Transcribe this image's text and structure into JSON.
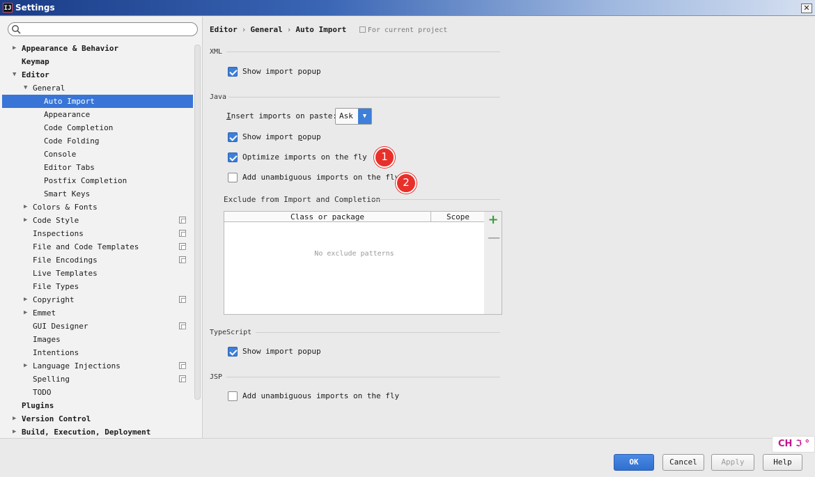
{
  "window": {
    "title": "Settings",
    "app_icon_text": "IJ",
    "close_label": "✕"
  },
  "search": {
    "placeholder": "",
    "value": ""
  },
  "tree": [
    {
      "label": "Appearance & Behavior",
      "depth": 0,
      "bold": true,
      "arrow": "▶",
      "selected": false,
      "project": false
    },
    {
      "label": "Keymap",
      "depth": 0,
      "bold": true,
      "arrow": "",
      "selected": false,
      "project": false
    },
    {
      "label": "Editor",
      "depth": 0,
      "bold": true,
      "arrow": "▼",
      "selected": false,
      "project": false
    },
    {
      "label": "General",
      "depth": 1,
      "bold": false,
      "arrow": "▼",
      "selected": false,
      "project": false
    },
    {
      "label": "Auto Import",
      "depth": 2,
      "bold": false,
      "arrow": "",
      "selected": true,
      "project": false
    },
    {
      "label": "Appearance",
      "depth": 2,
      "bold": false,
      "arrow": "",
      "selected": false,
      "project": false
    },
    {
      "label": "Code Completion",
      "depth": 2,
      "bold": false,
      "arrow": "",
      "selected": false,
      "project": false
    },
    {
      "label": "Code Folding",
      "depth": 2,
      "bold": false,
      "arrow": "",
      "selected": false,
      "project": false
    },
    {
      "label": "Console",
      "depth": 2,
      "bold": false,
      "arrow": "",
      "selected": false,
      "project": false
    },
    {
      "label": "Editor Tabs",
      "depth": 2,
      "bold": false,
      "arrow": "",
      "selected": false,
      "project": false
    },
    {
      "label": "Postfix Completion",
      "depth": 2,
      "bold": false,
      "arrow": "",
      "selected": false,
      "project": false
    },
    {
      "label": "Smart Keys",
      "depth": 2,
      "bold": false,
      "arrow": "",
      "selected": false,
      "project": false
    },
    {
      "label": "Colors & Fonts",
      "depth": 1,
      "bold": false,
      "arrow": "▶",
      "selected": false,
      "project": false
    },
    {
      "label": "Code Style",
      "depth": 1,
      "bold": false,
      "arrow": "▶",
      "selected": false,
      "project": true
    },
    {
      "label": "Inspections",
      "depth": 1,
      "bold": false,
      "arrow": "",
      "selected": false,
      "project": true
    },
    {
      "label": "File and Code Templates",
      "depth": 1,
      "bold": false,
      "arrow": "",
      "selected": false,
      "project": true
    },
    {
      "label": "File Encodings",
      "depth": 1,
      "bold": false,
      "arrow": "",
      "selected": false,
      "project": true
    },
    {
      "label": "Live Templates",
      "depth": 1,
      "bold": false,
      "arrow": "",
      "selected": false,
      "project": false
    },
    {
      "label": "File Types",
      "depth": 1,
      "bold": false,
      "arrow": "",
      "selected": false,
      "project": false
    },
    {
      "label": "Copyright",
      "depth": 1,
      "bold": false,
      "arrow": "▶",
      "selected": false,
      "project": true
    },
    {
      "label": "Emmet",
      "depth": 1,
      "bold": false,
      "arrow": "▶",
      "selected": false,
      "project": false
    },
    {
      "label": "GUI Designer",
      "depth": 1,
      "bold": false,
      "arrow": "",
      "selected": false,
      "project": true
    },
    {
      "label": "Images",
      "depth": 1,
      "bold": false,
      "arrow": "",
      "selected": false,
      "project": false
    },
    {
      "label": "Intentions",
      "depth": 1,
      "bold": false,
      "arrow": "",
      "selected": false,
      "project": false
    },
    {
      "label": "Language Injections",
      "depth": 1,
      "bold": false,
      "arrow": "▶",
      "selected": false,
      "project": true
    },
    {
      "label": "Spelling",
      "depth": 1,
      "bold": false,
      "arrow": "",
      "selected": false,
      "project": true
    },
    {
      "label": "TODO",
      "depth": 1,
      "bold": false,
      "arrow": "",
      "selected": false,
      "project": false
    },
    {
      "label": "Plugins",
      "depth": 0,
      "bold": true,
      "arrow": "",
      "selected": false,
      "project": false
    },
    {
      "label": "Version Control",
      "depth": 0,
      "bold": true,
      "arrow": "▶",
      "selected": false,
      "project": false
    },
    {
      "label": "Build, Execution, Deployment",
      "depth": 0,
      "bold": true,
      "arrow": "▶",
      "selected": false,
      "project": false
    }
  ],
  "breadcrumb": {
    "items": [
      "Editor",
      "General",
      "Auto Import"
    ],
    "separator": "›",
    "project_note": "For current project"
  },
  "sections": {
    "xml": {
      "title": "XML",
      "show_import_popup": {
        "label": "Show import popup",
        "checked": true
      }
    },
    "java": {
      "title": "Java",
      "insert_on_paste": {
        "label_pre": "I",
        "label_rest": "nsert imports on paste:",
        "value": "Ask"
      },
      "show_import_popup": {
        "label_pre": "Show import ",
        "label_u": "p",
        "label_rest": "opup",
        "checked": true
      },
      "optimize_on_fly": {
        "label": "Optimize imports on the fly",
        "checked": true
      },
      "unambiguous_on_fly": {
        "label": "Add unambiguous imports on the fly",
        "checked": false
      },
      "exclude_title": "Exclude from Import and Completion",
      "exclude_columns": [
        "Class or package",
        "Scope"
      ],
      "exclude_empty": "No exclude patterns"
    },
    "typescript": {
      "title": "TypeScript",
      "show_import_popup": {
        "label": "Show import popup",
        "checked": true
      }
    },
    "jsp": {
      "title": "JSP",
      "unambiguous_on_fly": {
        "label": "Add unambiguous imports on the fly",
        "checked": false
      }
    }
  },
  "badges": [
    "1",
    "2"
  ],
  "table_tools": {
    "add": "+",
    "remove": "—"
  },
  "buttons": {
    "ok": "OK",
    "cancel": "Cancel",
    "apply": "Apply",
    "help": "Help"
  },
  "ime": {
    "text": "CH ℑ °"
  },
  "colors": {
    "selection": "#3875d7",
    "checkbox": "#3d7fd9",
    "badge": "#e8302b",
    "add_icon": "#3a9b3a"
  }
}
